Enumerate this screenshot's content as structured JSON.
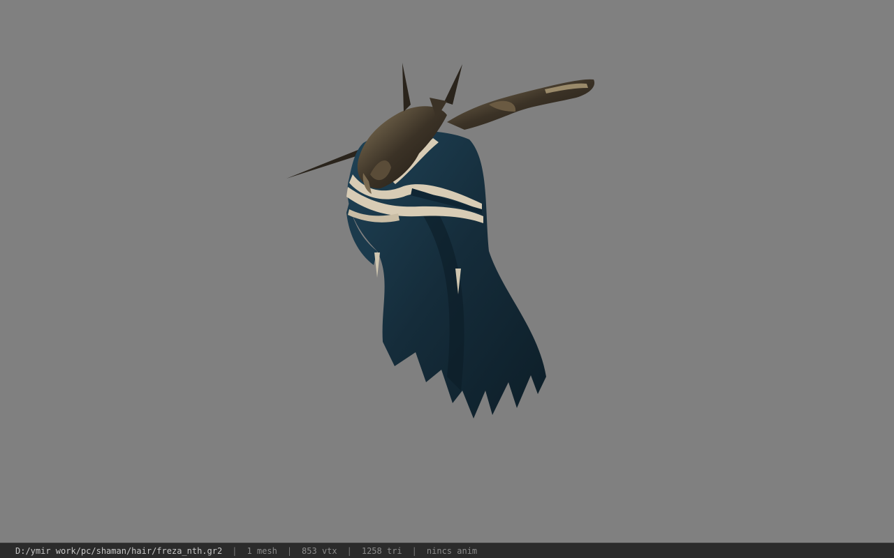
{
  "viewer": {
    "background_color": "#808080",
    "model": {
      "description_icon": "hair-model-icon",
      "cloth_color": "#17313f",
      "band_color": "#d8ccb5",
      "ornament_color": "#3a3226"
    }
  },
  "status_bar": {
    "file_path": "D:/ymir work/pc/shaman/hair/freza_nth.gr2",
    "separator": "|",
    "mesh_count": "1 mesh",
    "vertex_count": "853 vtx",
    "triangle_count": "1258 tri",
    "anim_state": "nincs anim"
  }
}
